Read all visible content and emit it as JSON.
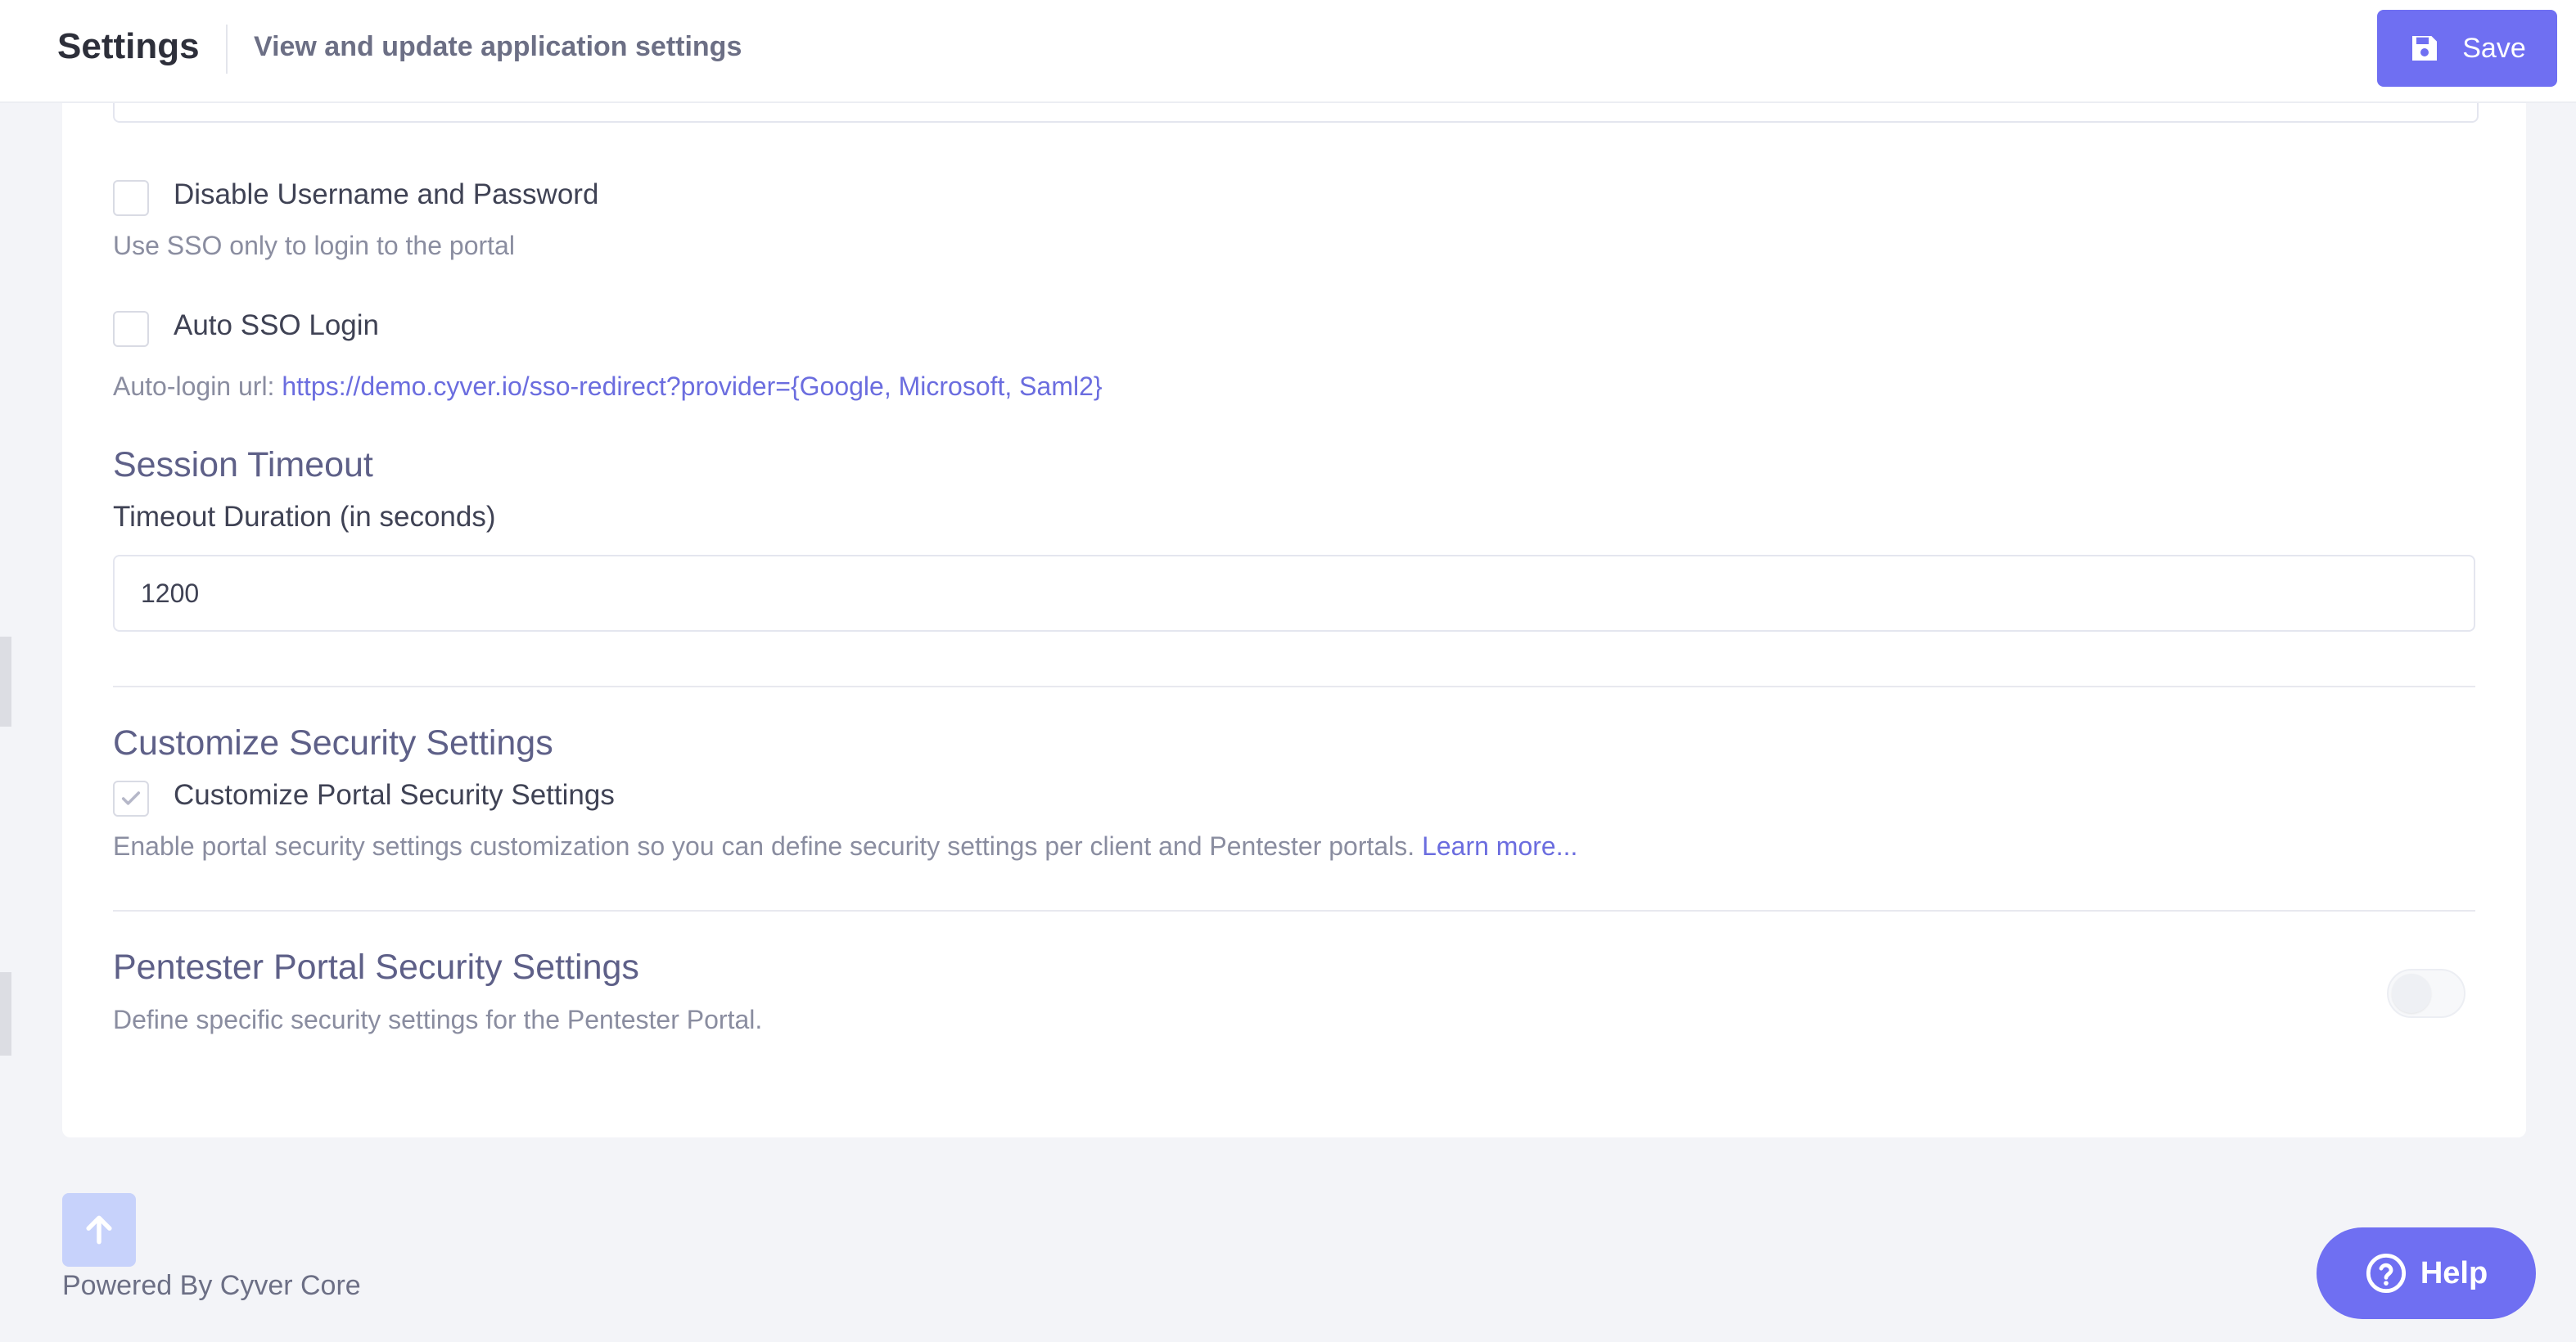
{
  "header": {
    "title": "Settings",
    "subtitle": "View and update application settings",
    "save_label": "Save"
  },
  "sso": {
    "disable_userpass_label": "Disable Username and Password",
    "disable_userpass_help": "Use SSO only to login to the portal",
    "auto_sso_label": "Auto SSO Login",
    "auto_login_prefix": "Auto-login url:",
    "auto_login_url": "https://demo.cyver.io/sso-redirect?provider={Google, Microsoft, Saml2}"
  },
  "session": {
    "title": "Session Timeout",
    "duration_label": "Timeout Duration (in seconds)",
    "duration_value": "1200"
  },
  "customize": {
    "title": "Customize Security Settings",
    "checkbox_label": "Customize Portal Security Settings",
    "checked": true,
    "help": "Enable portal security settings customization so you can define security settings per client and Pentester portals.",
    "learn_more": "Learn more..."
  },
  "pentester": {
    "title": "Pentester Portal Security Settings",
    "help": "Define specific security settings for the Pentester Portal.",
    "enabled": false
  },
  "footer": {
    "powered_by": "Powered By Cyver Core",
    "help_label": "Help"
  },
  "colors": {
    "accent": "#6f6ff2",
    "link": "#6b6ddf",
    "section_title": "#5e6088",
    "background": "#f3f4f8"
  },
  "icons": {
    "save": "floppy-disk-icon",
    "check": "check-icon",
    "scroll_top": "arrow-up-icon",
    "help": "question-circle-icon"
  }
}
